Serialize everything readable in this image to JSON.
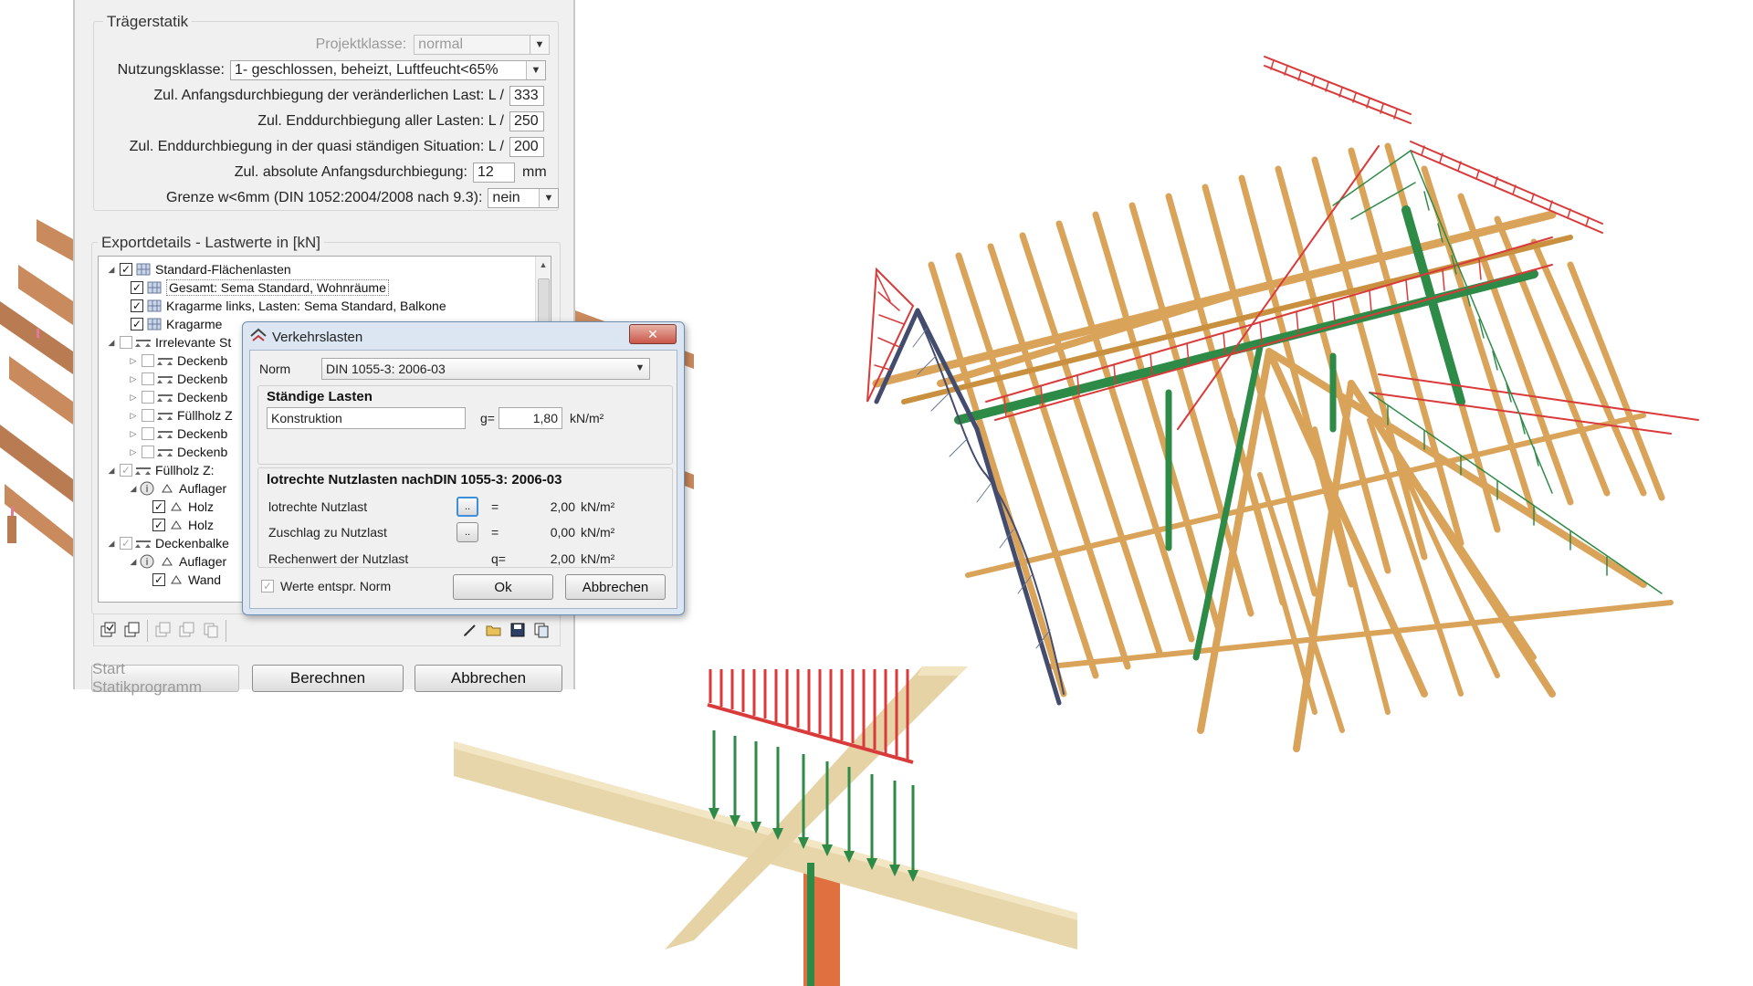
{
  "traegerstatik": {
    "title": "Trägerstatik",
    "projektklasse_label": "Projektklasse:",
    "projektklasse_value": "normal",
    "nutzungsklasse_label": "Nutzungsklasse:",
    "nutzungsklasse_value": "1- geschlossen, beheizt, Luftfeucht<65%",
    "anfangsdurchbiegung_label": "Zul. Anfangsdurchbiegung der veränderlichen Last: L /",
    "anfangsdurchbiegung_value": "333",
    "enddurchbiegung_label": "Zul. Enddurchbiegung aller Lasten: L /",
    "enddurchbiegung_value": "250",
    "enddurchbiegung_quasi_label": "Zul. Enddurchbiegung in der quasi ständigen Situation: L /",
    "enddurchbiegung_quasi_value": "200",
    "absolute_label": "Zul. absolute Anfangsdurchbiegung:",
    "absolute_value": "12",
    "absolute_unit": "mm",
    "grenze_label": "Grenze w<6mm (DIN 1052:2004/2008 nach 9.3):",
    "grenze_value": "nein"
  },
  "exportdetails": {
    "title": "Exportdetails - Lastwerte in [kN]",
    "tree": [
      {
        "label": "Standard-Flächenlasten"
      },
      {
        "label": "Gesamt: Sema Standard, Wohnräume"
      },
      {
        "label": "Kragarme links, Lasten: Sema Standard, Balkone"
      },
      {
        "label": "Kragarme"
      },
      {
        "label": "Irrelevante St"
      },
      {
        "label": "Deckenb"
      },
      {
        "label": "Deckenb"
      },
      {
        "label": "Deckenb"
      },
      {
        "label": "Füllholz Z"
      },
      {
        "label": "Deckenb"
      },
      {
        "label": "Deckenb"
      },
      {
        "label": "Füllholz Z:"
      },
      {
        "label": "Auflager"
      },
      {
        "label": "Holz"
      },
      {
        "label": "Holz"
      },
      {
        "label": "Deckenbalke"
      },
      {
        "label": "Auflager"
      },
      {
        "label": "Wand"
      }
    ]
  },
  "buttons": {
    "start": "Start Statikprogramm",
    "berechnen": "Berechnen",
    "abbrechen": "Abbrechen"
  },
  "dialog": {
    "title": "Verkehrslasten",
    "close": "✕",
    "norm_label": "Norm",
    "norm_value": "DIN 1055-3: 2006-03",
    "staendige_title": "Ständige Lasten",
    "konstruktion_value": "Konstruktion",
    "g_label": "g=",
    "g_value": "1,80",
    "g_unit": "kN/m²",
    "lotrechte_title": "lotrechte Nutzlasten nachDIN 1055-3: 2006-03",
    "nutzlast_label": "lotrechte Nutzlast",
    "nutzlast_value": "2,00",
    "nutzlast_unit": "kN/m²",
    "zuschlag_label": "Zuschlag zu Nutzlast",
    "zuschlag_value": "0,00",
    "zuschlag_unit": "kN/m²",
    "rechenwert_label": "Rechenwert der Nutzlast",
    "q_label": "q=",
    "rechenwert_value": "2,00",
    "rechenwert_unit": "kN/m²",
    "eq": "=",
    "dots": "..",
    "werte_label": "Werte entspr. Norm",
    "ok": "Ok",
    "abbrechen": "Abbrechen"
  },
  "colors": {
    "timber": "#d9a45a",
    "load_red": "#d93a3a",
    "load_green": "#2f8a4a",
    "window_bg": "#f0f0f0",
    "dialog_frame": "#dbe6f2"
  }
}
